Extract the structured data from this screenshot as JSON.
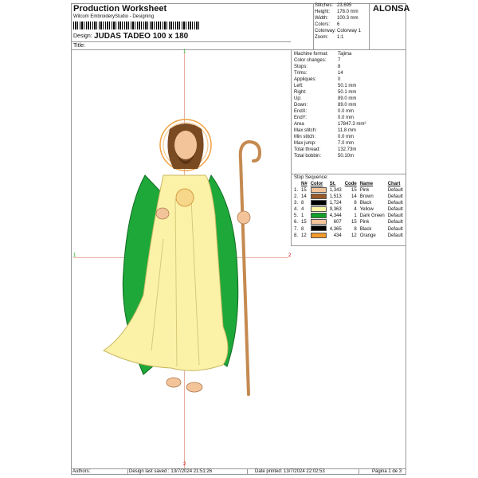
{
  "header": {
    "title": "Production Worksheet",
    "subtitle": "Wilcom EmbroideryStudio - Designing",
    "design_label": "Design:",
    "design_name": "JUDAS TADEO 100 x 180",
    "title_label": "Title:",
    "brand": "ALONSA"
  },
  "stats_top": [
    {
      "k": "Stitches:",
      "v": "23,695"
    },
    {
      "k": "Height:",
      "v": "178.0 mm"
    },
    {
      "k": "Width:",
      "v": "100.3 mm"
    },
    {
      "k": "Colors:",
      "v": "6"
    },
    {
      "k": "Colorway:",
      "v": "Colorway 1"
    },
    {
      "k": "Zoom:",
      "v": "1:1"
    }
  ],
  "stats_side": [
    {
      "k": "Machine format:",
      "v": "Tajima"
    },
    {
      "k": "Color changes:",
      "v": "7"
    },
    {
      "k": "Stops:",
      "v": "8"
    },
    {
      "k": "Trims:",
      "v": "14"
    },
    {
      "k": "Appliqués:",
      "v": "0"
    },
    {
      "k": "Left:",
      "v": "50.1 mm"
    },
    {
      "k": "Right:",
      "v": "50.1 mm"
    },
    {
      "k": "Up:",
      "v": "89.0 mm"
    },
    {
      "k": "Down:",
      "v": "89.0 mm"
    },
    {
      "k": "EndX:",
      "v": "0.0 mm"
    },
    {
      "k": "EndY:",
      "v": "0.0 mm"
    },
    {
      "k": "Area",
      "v": "17847.3 mm²"
    },
    {
      "k": "Max stitch:",
      "v": "11.8 mm"
    },
    {
      "k": "Min stitch:",
      "v": "0.0 mm"
    },
    {
      "k": "Max jump:",
      "v": "7.0 mm"
    },
    {
      "k": "Total thread:",
      "v": "132.73m"
    },
    {
      "k": "Total bobbin:",
      "v": "50.10m"
    }
  ],
  "stop_sequence": {
    "title": "Stop Sequence:",
    "headers": [
      "N#",
      "Color",
      "St.",
      "Code",
      "Name",
      "Chart"
    ],
    "rows": [
      {
        "idx": "1.",
        "n": "15",
        "color": "#f3c39a",
        "st": "1,343",
        "code": "15",
        "name": "Pink",
        "chart": "Default"
      },
      {
        "idx": "2.",
        "n": "14",
        "color": "#9a5a2a",
        "st": "1,513",
        "code": "14",
        "name": "Brown",
        "chart": "Default"
      },
      {
        "idx": "3.",
        "n": "8",
        "color": "#000000",
        "st": "1,724",
        "code": "8",
        "name": "Black",
        "chart": "Default"
      },
      {
        "idx": "4.",
        "n": "4",
        "color": "#fdf7a6",
        "st": "9,363",
        "code": "4",
        "name": "Yellow",
        "chart": "Default"
      },
      {
        "idx": "5.",
        "n": "1",
        "color": "#12a02a",
        "st": "4,344",
        "code": "1",
        "name": "Dark Green",
        "chart": "Default"
      },
      {
        "idx": "6.",
        "n": "15",
        "color": "#f3c39a",
        "st": "607",
        "code": "15",
        "name": "Pink",
        "chart": "Default"
      },
      {
        "idx": "7.",
        "n": "8",
        "color": "#000000",
        "st": "4,365",
        "code": "8",
        "name": "Black",
        "chart": "Default"
      },
      {
        "idx": "8.",
        "n": "12",
        "color": "#f29a2a",
        "st": "434",
        "code": "12",
        "name": "Orange",
        "chart": "Default"
      }
    ]
  },
  "axis": {
    "top": "1",
    "bottom": "2",
    "left": "1",
    "right": "2"
  },
  "footer": {
    "authors": "Authors:",
    "saved": "Design last saved : 13/7/2024 21:51:26",
    "printed": "Date printed: 13/7/2024 22:02:53",
    "page": "Página 1 de 3"
  }
}
